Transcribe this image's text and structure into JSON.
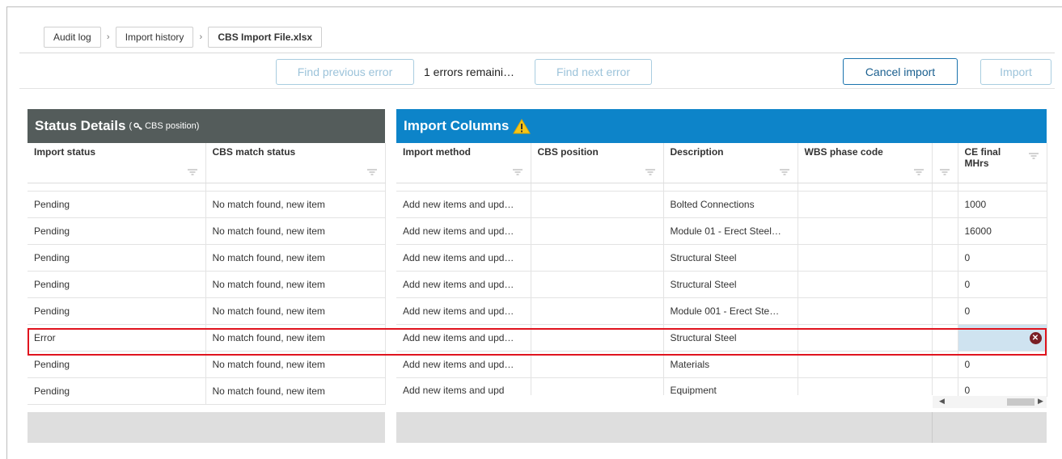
{
  "breadcrumb": [
    "Audit log",
    "Import history",
    "CBS Import File.xlsx"
  ],
  "toolbar": {
    "find_previous": "Find previous error",
    "errors_remaining": "1 errors remaini…",
    "find_next": "Find next error",
    "cancel_import": "Cancel import",
    "import": "Import"
  },
  "status_panel": {
    "title": "Status Details",
    "subtitle_open": "(",
    "subtitle_text": "CBS position)",
    "columns": [
      "Import status",
      "CBS match status"
    ],
    "rows": [
      [
        "Pending",
        "No match found, new item"
      ],
      [
        "Pending",
        "No match found, new item"
      ],
      [
        "Pending",
        "No match found, new item"
      ],
      [
        "Pending",
        "No match found, new item"
      ],
      [
        "Pending",
        "No match found, new item"
      ],
      [
        "Error",
        "No match found, new item"
      ],
      [
        "Pending",
        "No match found, new item"
      ],
      [
        "Pending",
        "No match found, new item"
      ]
    ]
  },
  "import_panel": {
    "title": "Import Columns",
    "columns": [
      "Import method",
      "CBS position",
      "Description",
      "WBS phase code",
      "",
      "CE final MHrs"
    ],
    "rows": [
      [
        "Add new items and upd…",
        "",
        "Bolted Connections",
        "",
        "",
        "1000"
      ],
      [
        "Add new items and upd…",
        "",
        "Module 01 - Erect Steel…",
        "",
        "",
        "16000"
      ],
      [
        "Add new items and upd…",
        "",
        "Structural Steel",
        "",
        "",
        "0"
      ],
      [
        "Add new items and upd…",
        "",
        "Structural Steel",
        "",
        "",
        "0"
      ],
      [
        "Add new items and upd…",
        "",
        "Module 001 - Erect Ste…",
        "",
        "",
        "0"
      ],
      [
        "Add new items and upd…",
        "",
        "Structural Steel",
        "",
        "",
        ""
      ],
      [
        "Add new items and upd…",
        "",
        "Materials",
        "",
        "",
        "0"
      ],
      [
        "Add new items and upd",
        "",
        "Equipment",
        "",
        "",
        "0"
      ]
    ]
  },
  "colors": {
    "status_header": "#545c5b",
    "import_header": "#0d84c9",
    "error_outline": "#e0141e",
    "error_cell": "#cfe3f0"
  },
  "icons": {
    "subtitle": "key-icon",
    "import_header": "warning-icon",
    "error_cell": "error-icon"
  }
}
